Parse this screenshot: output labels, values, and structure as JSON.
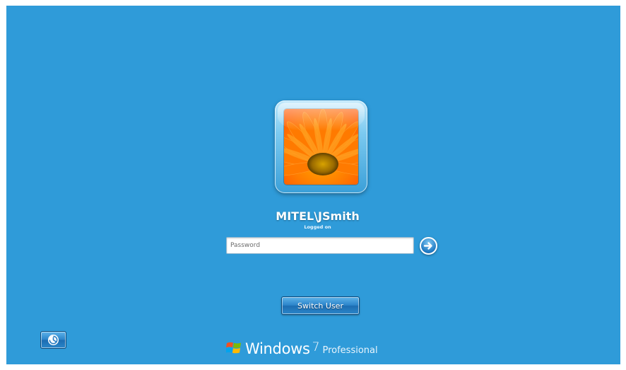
{
  "user": {
    "account_name": "MITEL\\JSmith",
    "status": "Logged on",
    "avatar_icon": "flower-icon"
  },
  "password": {
    "placeholder": "Password",
    "value": ""
  },
  "actions": {
    "switch_user_label": "Switch User",
    "submit_icon": "arrow-right-icon",
    "ease_of_access_icon": "ease-of-access-icon"
  },
  "branding": {
    "product": "Windows",
    "version": "7",
    "edition": "Professional",
    "logo_icon": "windows-flag-icon"
  },
  "colors": {
    "background": "#2f9bd9",
    "button_accent": "#2b84c9"
  }
}
